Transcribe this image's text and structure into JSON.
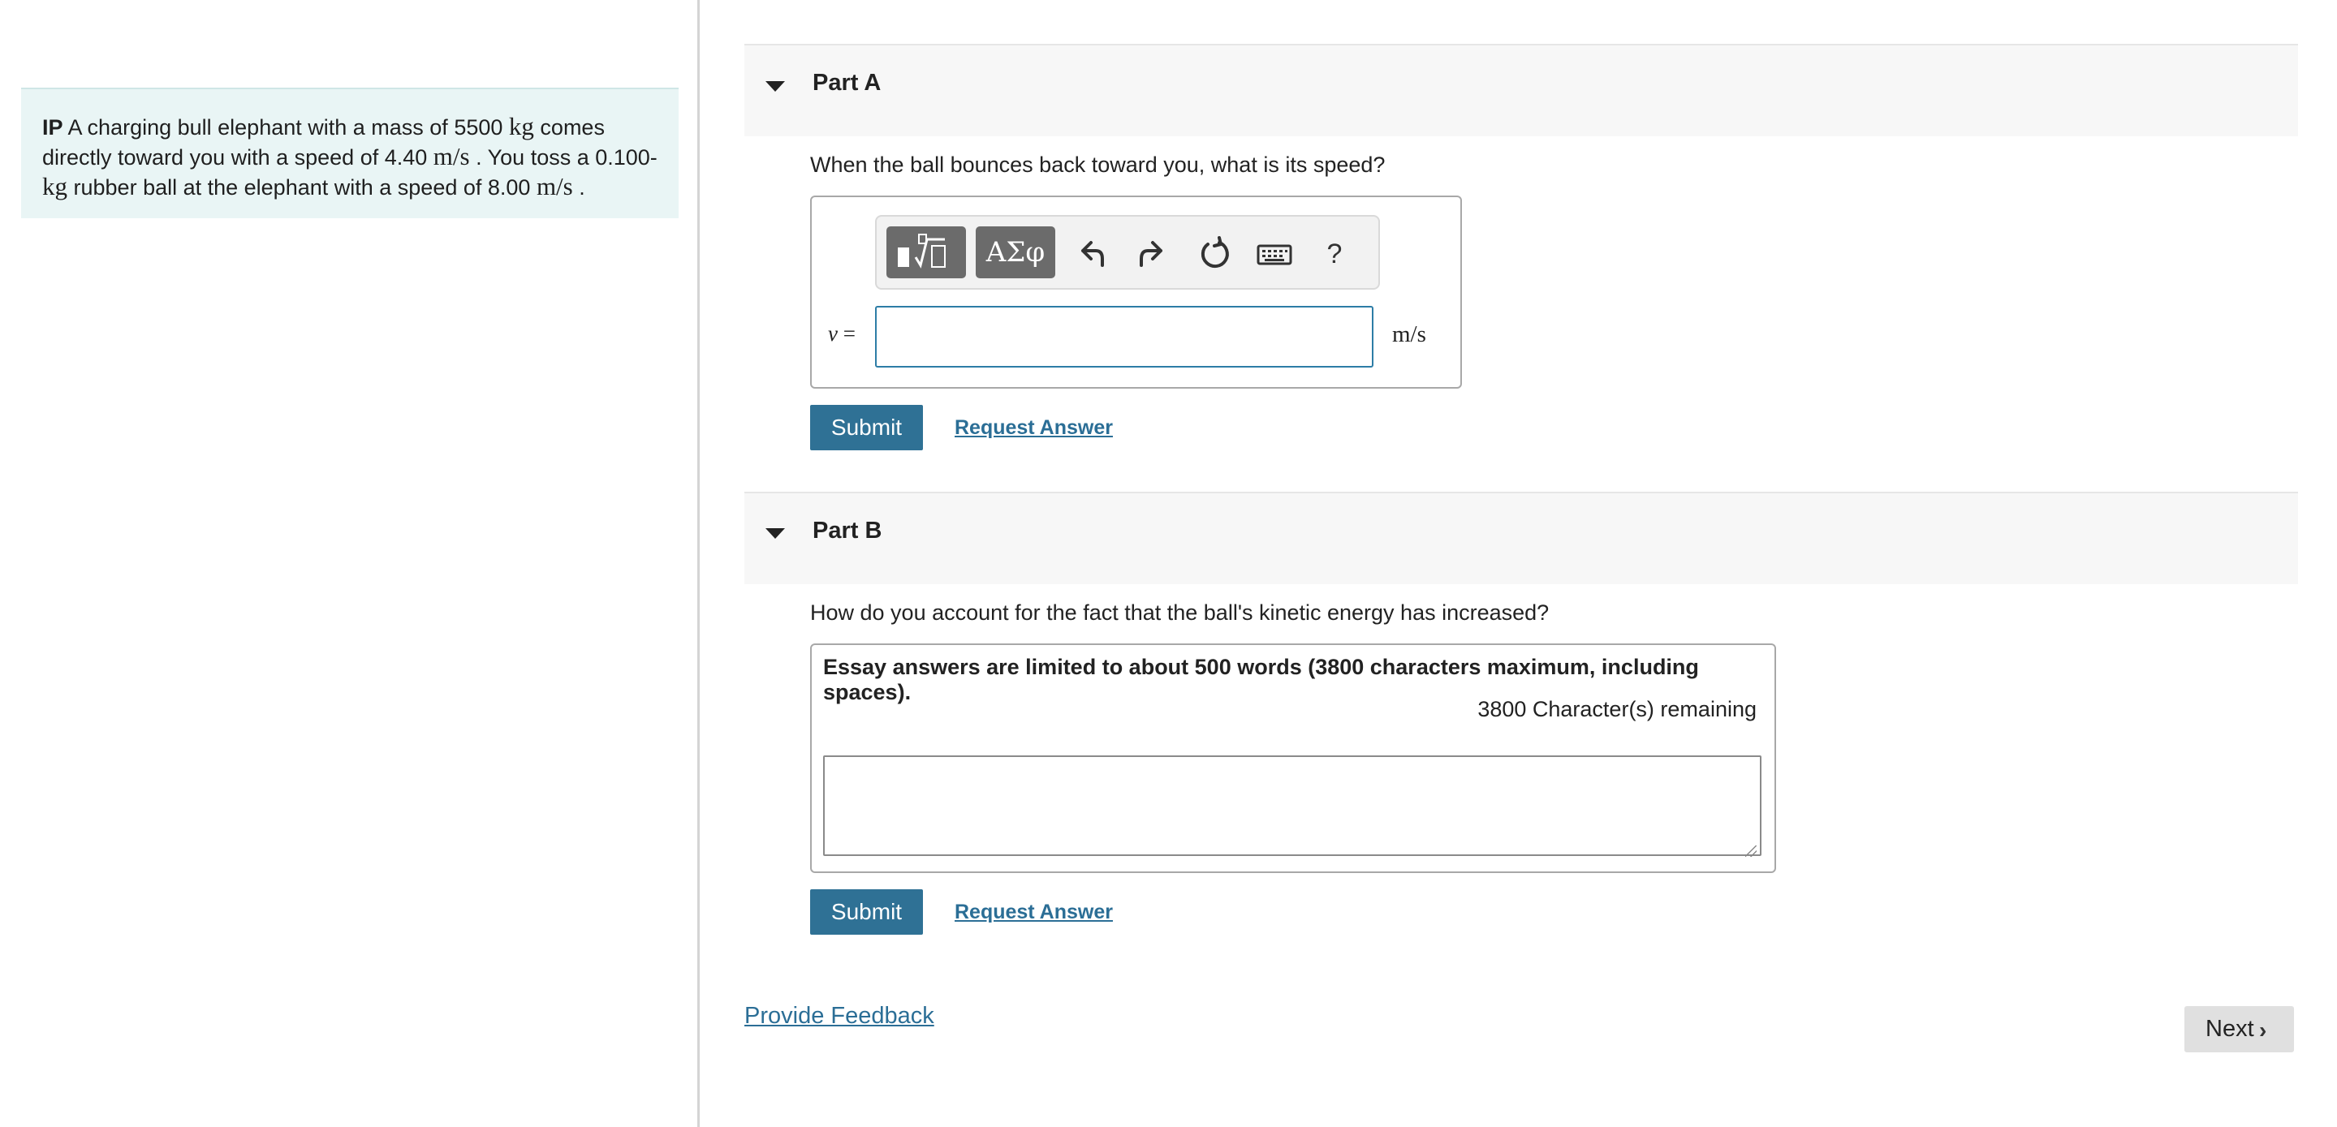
{
  "problem": {
    "prefix": "IP",
    "seg1": "A charging bull elephant with a mass of 5500",
    "unit_kg": "kg",
    "seg2": "comes directly toward you with a speed of 4.40",
    "unit_ms": "m/s",
    "seg3": ". You toss a 0.100-",
    "seg4": "rubber ball at the elephant with a speed of 8.00",
    "seg5": "."
  },
  "partA": {
    "title": "Part A",
    "question": "When the ball bounces back toward you, what is its speed?",
    "toolbar": {
      "templates_icon": "templates-icon",
      "greek_label": "ΑΣφ",
      "undo_icon": "undo-icon",
      "redo_icon": "redo-icon",
      "reset_icon": "reset-icon",
      "keyboard_icon": "keyboard-icon",
      "help_label": "?"
    },
    "variable": "v",
    "equals": "=",
    "input_value": "",
    "unit": "m/s",
    "submit_label": "Submit",
    "request_label": "Request Answer"
  },
  "partB": {
    "title": "Part B",
    "question": "How do you account for the fact that the ball's kinetic energy has increased?",
    "essay_note": "Essay answers are limited to about 500 words (3800 characters maximum, including spaces).",
    "remaining": "3800 Character(s) remaining",
    "textarea_value": "",
    "submit_label": "Submit",
    "request_label": "Request Answer"
  },
  "footer": {
    "feedback_label": "Provide Feedback",
    "next_label": "Next",
    "next_chevron": "›"
  },
  "colors": {
    "problem_bg": "#e9f5f5",
    "button_blue": "#2f7195",
    "link_blue": "#2b6e96",
    "input_border": "#2d7da6"
  }
}
